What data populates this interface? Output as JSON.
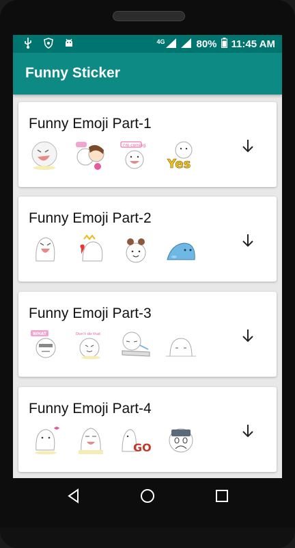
{
  "status_bar": {
    "icons": [
      "usb-icon",
      "shield-icon",
      "android-icon"
    ],
    "network": "4G",
    "battery": "80%",
    "time": "11:45 AM"
  },
  "app_bar": {
    "title": "Funny Sticker"
  },
  "packs": [
    {
      "title": "Funny Emoji Part-1",
      "stickers": [
        "laughing-ghost",
        "couple-hug",
        "im-coming",
        "yes-ghost"
      ]
    },
    {
      "title": "Funny Emoji Part-2",
      "stickers": [
        "shouting-ghost",
        "king-heart",
        "bun-hair-ghost",
        "blue-blob"
      ]
    },
    {
      "title": "Funny Emoji Part-3",
      "stickers": [
        "what-ghost",
        "dont-do-that",
        "crying-desk",
        "peeking-ghost"
      ]
    },
    {
      "title": "Funny Emoji Part-4",
      "stickers": [
        "dancing-ghost",
        "singing-ghost",
        "go-ghost",
        "scared-ghost"
      ]
    }
  ],
  "nav": {
    "icons": [
      "back-icon",
      "home-icon",
      "recents-icon"
    ]
  },
  "colors": {
    "status_bar": "#00756f",
    "app_bar": "#0e8a84",
    "background": "#e8e8e8"
  }
}
